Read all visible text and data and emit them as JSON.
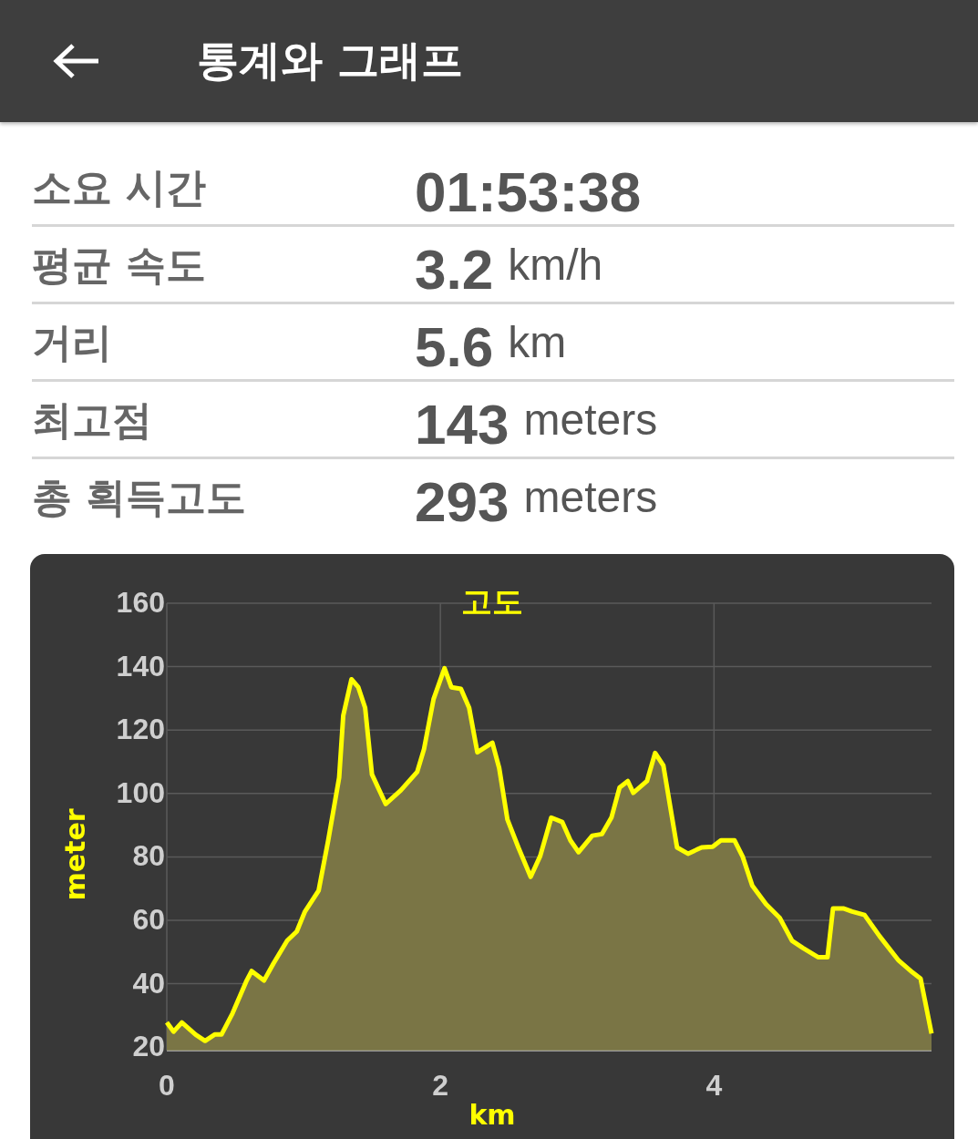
{
  "app_bar": {
    "title": "통계와 그래프"
  },
  "stats": [
    {
      "label": "소요 시간",
      "value": "01:53:38"
    },
    {
      "label": "평균 속도",
      "value": "3.2",
      "unit": "km/h"
    },
    {
      "label": "거리",
      "value": "5.6",
      "unit": "km"
    },
    {
      "label": "최고점",
      "value": "143",
      "unit": "meters"
    },
    {
      "label": "총 획득고도",
      "value": "293",
      "unit": "meters"
    }
  ],
  "elevation_card": {
    "chart_data": {
      "type": "area",
      "title": "고도",
      "xlabel": "km",
      "ylabel": "meter",
      "xlim": [
        0,
        5.59
      ],
      "ylim": [
        19,
        160
      ],
      "xticks": [
        0,
        2,
        4
      ],
      "yticks": [
        20,
        40,
        60,
        80,
        100,
        120,
        140,
        160
      ],
      "x": [
        0,
        0.05,
        0.11,
        0.21,
        0.28,
        0.35,
        0.4,
        0.48,
        0.58,
        0.62,
        0.71,
        0.78,
        0.88,
        0.95,
        1.01,
        1.11,
        1.18,
        1.26,
        1.29,
        1.35,
        1.4,
        1.45,
        1.5,
        1.6,
        1.71,
        1.83,
        1.88,
        1.95,
        2.03,
        2.08,
        2.15,
        2.21,
        2.27,
        2.38,
        2.43,
        2.49,
        2.57,
        2.66,
        2.73,
        2.81,
        2.89,
        2.95,
        3.01,
        3.11,
        3.18,
        3.25,
        3.31,
        3.37,
        3.41,
        3.51,
        3.57,
        3.63,
        3.73,
        3.81,
        3.91,
        3.99,
        4.05,
        4.15,
        4.21,
        4.28,
        4.38,
        4.48,
        4.57,
        4.65,
        4.76,
        4.83,
        4.87,
        4.95,
        5.01,
        5.1,
        5.21,
        5.35,
        5.45,
        5.51,
        5.59
      ],
      "grid": true,
      "series": [
        {
          "color": "#ffff00",
          "values": [
            27.8,
            24.9,
            27.8,
            24,
            22,
            24,
            24,
            30.6,
            40.7,
            44,
            41,
            46.4,
            53.6,
            56.5,
            62.8,
            69.4,
            85.2,
            105,
            124.6,
            136,
            133.5,
            127,
            106,
            96.7,
            101,
            106.8,
            114,
            129.8,
            139.5,
            133.5,
            133,
            127,
            113,
            116,
            108,
            91.8,
            83,
            73.7,
            80.3,
            92.4,
            91,
            85.2,
            81.5,
            86.7,
            87.2,
            92.4,
            101.9,
            103.9,
            100.2,
            103.9,
            112.8,
            108.8,
            83,
            81,
            83,
            83.2,
            85.2,
            85.2,
            80,
            70.9,
            65.1,
            60.8,
            53.6,
            51.3,
            48.4,
            48.4,
            63.7,
            63.7,
            62.8,
            61.7,
            55,
            47.3,
            43.6,
            41.6,
            24.3
          ]
        }
      ]
    }
  }
}
